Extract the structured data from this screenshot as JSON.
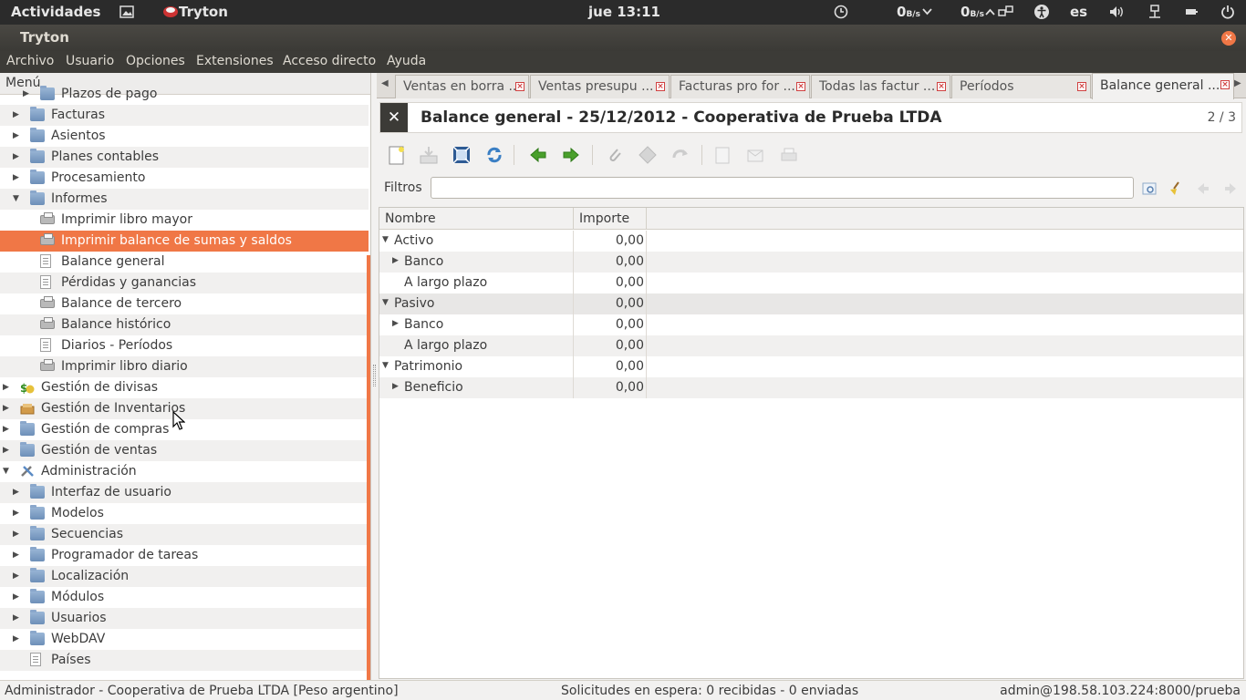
{
  "topbar": {
    "activities": "Actividades",
    "app_name": "Tryton",
    "clock": "jue 13:11",
    "net_down": "0",
    "net_down_unit": "B/s",
    "net_up": "0",
    "net_up_unit": "B/s",
    "lang": "es"
  },
  "window": {
    "title": "Tryton"
  },
  "menubar": [
    "Archivo",
    "Usuario",
    "Opciones",
    "Extensiones",
    "Acceso directo",
    "Ayuda"
  ],
  "sidebar": {
    "header": "Menú",
    "items": [
      {
        "label": "Plazos de pago",
        "level": 2,
        "icon": "folder-icon",
        "expander": "collapsed"
      },
      {
        "label": "Facturas",
        "level": 1,
        "icon": "folder-icon",
        "expander": "collapsed"
      },
      {
        "label": "Asientos",
        "level": 1,
        "icon": "folder-icon",
        "expander": "collapsed"
      },
      {
        "label": "Planes contables",
        "level": 1,
        "icon": "folder-icon",
        "expander": "collapsed"
      },
      {
        "label": "Procesamiento",
        "level": 1,
        "icon": "folder-icon",
        "expander": "collapsed"
      },
      {
        "label": "Informes",
        "level": 1,
        "icon": "folder-icon",
        "expander": "expanded"
      },
      {
        "label": "Imprimir libro mayor",
        "level": 2,
        "icon": "printer-icon",
        "expander": "none"
      },
      {
        "label": "Imprimir balance de sumas y saldos",
        "level": 2,
        "icon": "printer-icon",
        "expander": "none",
        "selected": true
      },
      {
        "label": "Balance general",
        "level": 2,
        "icon": "document-icon",
        "expander": "none"
      },
      {
        "label": "Pérdidas y ganancias",
        "level": 2,
        "icon": "document-icon",
        "expander": "none"
      },
      {
        "label": "Balance de tercero",
        "level": 2,
        "icon": "printer-icon",
        "expander": "none"
      },
      {
        "label": "Balance histórico",
        "level": 2,
        "icon": "printer-icon",
        "expander": "none"
      },
      {
        "label": "Diarios - Períodos",
        "level": 2,
        "icon": "document-icon",
        "expander": "none"
      },
      {
        "label": "Imprimir libro diario",
        "level": 2,
        "icon": "printer-icon",
        "expander": "none"
      },
      {
        "label": "Gestión de divisas",
        "level": 0,
        "icon": "currency-icon",
        "expander": "collapsed"
      },
      {
        "label": "Gestión de Inventarios",
        "level": 0,
        "icon": "inventory-icon",
        "expander": "collapsed"
      },
      {
        "label": "Gestión de compras",
        "level": 0,
        "icon": "folder-icon",
        "expander": "collapsed"
      },
      {
        "label": "Gestión de ventas",
        "level": 0,
        "icon": "folder-icon",
        "expander": "collapsed"
      },
      {
        "label": "Administración",
        "level": 0,
        "icon": "tools-icon",
        "expander": "expanded"
      },
      {
        "label": "Interfaz de usuario",
        "level": 1,
        "icon": "folder-icon",
        "expander": "collapsed"
      },
      {
        "label": "Modelos",
        "level": 1,
        "icon": "folder-icon",
        "expander": "collapsed"
      },
      {
        "label": "Secuencias",
        "level": 1,
        "icon": "folder-icon",
        "expander": "collapsed"
      },
      {
        "label": "Programador de tareas",
        "level": 1,
        "icon": "folder-icon",
        "expander": "collapsed"
      },
      {
        "label": "Localización",
        "level": 1,
        "icon": "folder-icon",
        "expander": "collapsed"
      },
      {
        "label": "Módulos",
        "level": 1,
        "icon": "folder-icon",
        "expander": "collapsed"
      },
      {
        "label": "Usuarios",
        "level": 1,
        "icon": "folder-icon",
        "expander": "collapsed"
      },
      {
        "label": "WebDAV",
        "level": 1,
        "icon": "folder-icon",
        "expander": "collapsed"
      },
      {
        "label": "Países",
        "level": 1,
        "icon": "document-icon",
        "expander": "none"
      }
    ]
  },
  "tabs": [
    {
      "label": "Ventas en borra ..."
    },
    {
      "label": "Ventas presupu ..."
    },
    {
      "label": "Facturas pro for ..."
    },
    {
      "label": "Todas las factur ..."
    },
    {
      "label": "Períodos"
    },
    {
      "label": "Balance general ...",
      "active": true
    }
  ],
  "form": {
    "title": "Balance general - 25/12/2012 - Cooperativa de Prueba LTDA",
    "record_count": "2 / 3",
    "filter_label": "Filtros",
    "filter_value": "",
    "columns": [
      "Nombre",
      "Importe"
    ],
    "rows": [
      {
        "name": "Activo",
        "amount": "0,00",
        "level": 0,
        "expander": "expanded"
      },
      {
        "name": "Banco",
        "amount": "0,00",
        "level": 1,
        "expander": "collapsed"
      },
      {
        "name": "A largo plazo",
        "amount": "0,00",
        "level": 1,
        "expander": "none"
      },
      {
        "name": "Pasivo",
        "amount": "0,00",
        "level": 0,
        "expander": "expanded",
        "selected": true
      },
      {
        "name": "Banco",
        "amount": "0,00",
        "level": 1,
        "expander": "collapsed"
      },
      {
        "name": "A largo plazo",
        "amount": "0,00",
        "level": 1,
        "expander": "none"
      },
      {
        "name": "Patrimonio",
        "amount": "0,00",
        "level": 0,
        "expander": "expanded"
      },
      {
        "name": "Beneficio",
        "amount": "0,00",
        "level": 1,
        "expander": "collapsed"
      }
    ]
  },
  "status": {
    "left": "Administrador - Cooperativa de Prueba LTDA [Peso argentino]",
    "center": "Solicitudes en espera: 0 recibidas - 0 enviadas",
    "right": "admin@198.58.103.224:8000/prueba"
  },
  "colors": {
    "accent": "#f07746",
    "topbar": "#2b2b2b",
    "menubar": "#3c3b37"
  }
}
